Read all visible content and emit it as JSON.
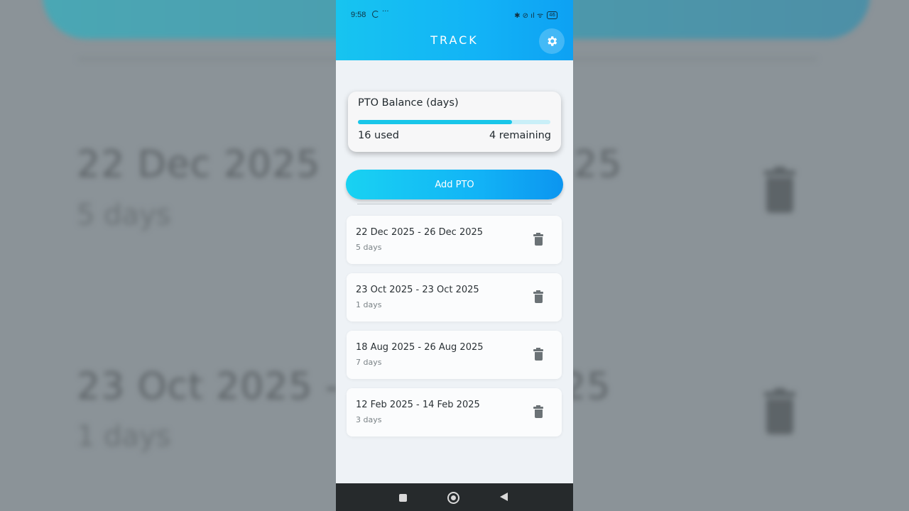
{
  "status_bar": {
    "time": "9:58",
    "dots": "···",
    "right_icons": "✱ ⊘ ıl ᯤ",
    "battery": "46"
  },
  "app_bar": {
    "title": "TRACK",
    "settings_icon": "gear-icon"
  },
  "balance": {
    "label": "PTO Balance (days)",
    "used_text": "16 used",
    "remaining_text": "4 remaining",
    "used": 16,
    "total": 20,
    "accent": "#19c6e9"
  },
  "add_button": {
    "label": "Add PTO"
  },
  "pto_entries": [
    {
      "range": "22 Dec 2025 - 26 Dec 2025",
      "days": "5 days"
    },
    {
      "range": "23 Oct 2025 - 23 Oct 2025",
      "days": "1 days"
    },
    {
      "range": "18 Aug 2025 - 26 Aug 2025",
      "days": "7 days"
    },
    {
      "range": "12 Feb 2025 - 14 Feb 2025",
      "days": "3 days"
    }
  ],
  "background_mirror": {
    "entry1_date": "22 Dec 2025",
    "entry1_date_right": "25",
    "entry1_days": "5 days",
    "entry2_date": "23 Oct 2025 -",
    "entry2_date_right": "25",
    "entry2_days": "1 days"
  },
  "colors": {
    "app_bar_start": "#17c4f0",
    "app_bar_end": "#0ea1f3",
    "trash": "#6b7276"
  }
}
